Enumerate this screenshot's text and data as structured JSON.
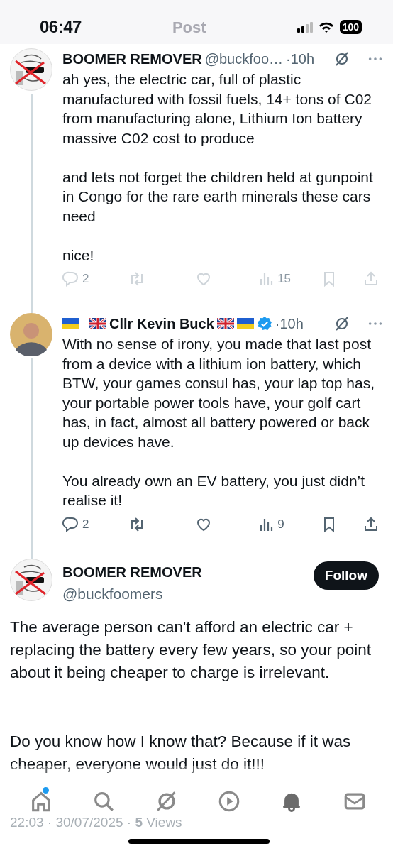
{
  "status_bar": {
    "time": "06:47",
    "battery": "100"
  },
  "header": {
    "title": "Post"
  },
  "replies": [
    {
      "flagged": false,
      "name": "BOOMER REMOVER",
      "verified": false,
      "handle": "@buckfoo…",
      "time": "·10h",
      "paragraphs": [
        "ah yes, the electric car, full of plastic manufactured with fossil fuels, 14+ tons of C02 from manufacturing alone, Lithium Ion battery massive C02 cost to produce",
        "and lets not forget the children held at gunpoint in Congo for the rare earth minerals these cars need",
        "nice!"
      ],
      "actions": {
        "dimmed": true,
        "reply_count": "2",
        "view_count": "15"
      }
    },
    {
      "flagged": true,
      "name": "Cllr Kevin Buck",
      "verified": true,
      "time": "·10h",
      "paragraphs": [
        "With no sense of irony, you made that last post from a device with a lithium ion battery, which BTW, your games consul has, your lap top has, your portable power tools have, your golf cart has, in fact, almost all battery powered or back up devices have.",
        "You already own an EV battery, you just didn’t realise it!"
      ],
      "actions": {
        "dimmed": false,
        "reply_count": "2",
        "view_count": "9"
      }
    }
  ],
  "main_post": {
    "name": "BOOMER REMOVER",
    "handle": "@buckfoomers",
    "follow_button": "Follow",
    "paragraphs": [
      "The average person can't afford an electric car + replacing the battery every few years, so your point about it being cheaper to charge is irrelevant.",
      "Do you know how I know that? Because if it was cheaper, everyone would just do it!!!"
    ],
    "meta": "22:03 · 30/07/2025 · **5** Views"
  },
  "tab_bar": {
    "items": [
      {
        "kind": "home",
        "selected": false,
        "badge": true
      },
      {
        "kind": "search",
        "selected": false,
        "badge": false
      },
      {
        "kind": "grok",
        "selected": false,
        "badge": false
      },
      {
        "kind": "video",
        "selected": false,
        "badge": false
      },
      {
        "kind": "bell",
        "selected": true,
        "badge": false
      },
      {
        "kind": "mail",
        "selected": false,
        "badge": false
      }
    ]
  }
}
